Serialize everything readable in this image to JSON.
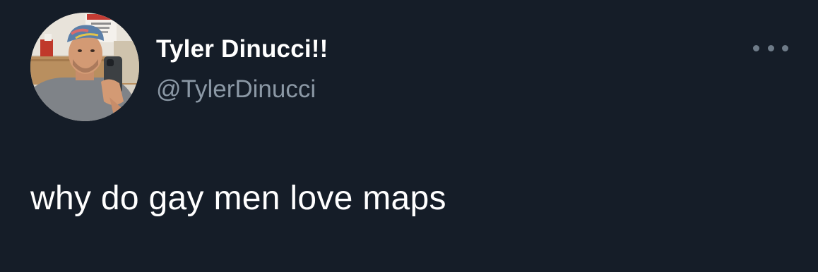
{
  "author": {
    "display_name": "Tyler Dinucci!!",
    "handle": "@TylerDinucci"
  },
  "tweet": {
    "text": "why do gay men love maps"
  },
  "icons": {
    "more": "more-horizontal-icon"
  },
  "colors": {
    "background": "#151d28",
    "primary_text": "#ffffff",
    "secondary_text": "#8b98a5"
  }
}
